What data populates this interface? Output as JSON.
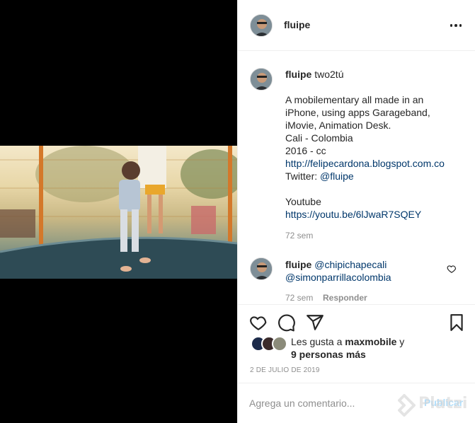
{
  "post": {
    "username": "fluipe"
  },
  "caption": {
    "username": "fluipe",
    "title": "two2tú",
    "lines": [
      "A mobilementary all made in an",
      "iPhone, using apps Garageband,",
      "iMovie, Animation Desk.",
      "Cali - Colombia",
      "2016 - cc"
    ],
    "blog_link": "http://felipecardona.blogspot.com.co",
    "twitter_prefix": "Twitter: ",
    "twitter_handle": "@fluipe",
    "youtube_label": "Youtube",
    "youtube_link": "https://youtu.be/6lJwaR7SQEY",
    "time": "72 sem"
  },
  "comment": {
    "username": "fluipe",
    "mention1": "@chipichapecali",
    "mention2": "@simonparrillacolombia",
    "time": "72 sem",
    "reply_label": "Responder"
  },
  "likes": {
    "prefix": "Les gusta a ",
    "user": "maxmobile",
    "conjunction": " y",
    "others": "9 personas más"
  },
  "date": "2 de julio de 2019",
  "comment_box": {
    "placeholder": "Agrega un comentario...",
    "publish_label": "Publicar"
  },
  "watermark": "Platzi",
  "icons": [
    "more-options-icon",
    "heart-icon",
    "comment-icon",
    "share-icon",
    "bookmark-icon",
    "like-comment-heart-icon",
    "platzi-logo-icon"
  ],
  "colors": {
    "link": "#00376b",
    "muted": "#8e8e8e",
    "publish_disabled": "#b2dffc"
  }
}
